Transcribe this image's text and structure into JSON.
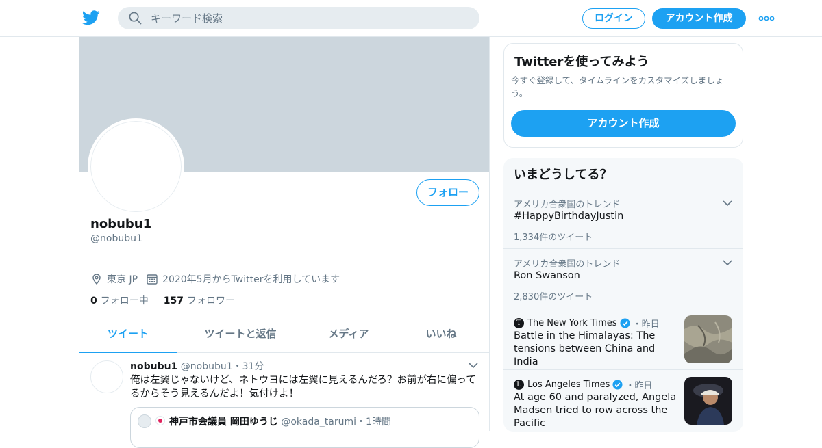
{
  "header": {
    "search_placeholder": "キーワード検索",
    "login_label": "ログイン",
    "signup_label": "アカウント作成"
  },
  "profile": {
    "display_name": "nobubu1",
    "handle": "@nobubu1",
    "follow_label": "フォロー",
    "location": "東京 JP",
    "joined": "2020年5月からTwitterを利用しています",
    "following_count": "0",
    "following_label": "フォロー中",
    "followers_count": "157",
    "followers_label": "フォロワー"
  },
  "tabs": [
    {
      "label": "ツイート"
    },
    {
      "label": "ツイートと返信"
    },
    {
      "label": "メディア"
    },
    {
      "label": "いいね"
    }
  ],
  "tweet": {
    "name": "nobubu1",
    "handle": "@nobubu1",
    "separator": "・",
    "time": "31分",
    "text": "俺は左翼じゃないけど、ネトウヨには左翼に見えるんだろ？お前が右に偏ってるからそう見えるんだよ！気付けよ！",
    "quote": {
      "name": "神戸市会議員 岡田ゆうじ",
      "handle": "@okada_tarumi",
      "separator": "・",
      "time": "1時間"
    }
  },
  "signup_card": {
    "title": "Twitterを使ってみよう",
    "subtitle": "今すぐ登録して、タイムラインをカスタマイズしましょう。",
    "button_label": "アカウント作成"
  },
  "trends_card": {
    "title": "いまどうしてる？",
    "trends": [
      {
        "context": "アメリカ合衆国のトレンド",
        "name": "#HappyBirthdayJustin",
        "count": "1,334件のツイート"
      },
      {
        "context": "アメリカ合衆国のトレンド",
        "name": "Ron Swanson",
        "count": "2,830件のツイート"
      }
    ],
    "news": [
      {
        "source": "The New York Times",
        "separator": "・",
        "time": "昨日",
        "headline": "Battle in the Himalayas: The tensions between China and India"
      },
      {
        "source": "Los Angeles Times",
        "separator": "・",
        "time": "昨日",
        "headline": "At age 60 and paralyzed, Angela Madsen tried to row across the Pacific"
      }
    ]
  },
  "colors": {
    "accent": "#1da1f2",
    "banner": "#ccd6dd",
    "secondary_text": "#657786"
  }
}
